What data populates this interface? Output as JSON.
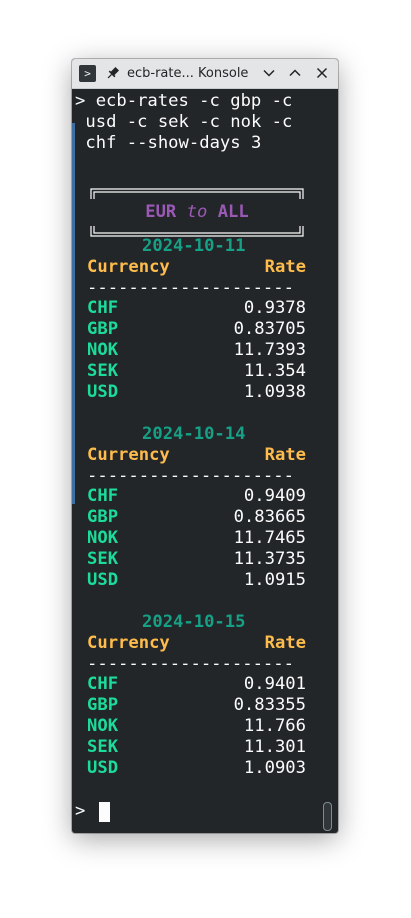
{
  "window": {
    "title": "ecb-rate... Konsole",
    "app_icon_glyph": ">",
    "icons": {
      "app": "terminal-icon",
      "pin": "pin-icon",
      "minimize": "chevron-down-icon",
      "maximize": "chevron-up-icon",
      "close": "close-icon"
    }
  },
  "terminal": {
    "prompt": ">",
    "command_lines": [
      "> ecb-rates -c gbp -c",
      "usd -c sek -c nok -c",
      "chf --show-days 3"
    ],
    "banner": {
      "from": "EUR",
      "to_word": "to",
      "to": "ALL"
    },
    "header": {
      "currency": "Currency",
      "rate": "Rate"
    },
    "divider": "--------------------",
    "days": [
      {
        "date": "2024-10-11",
        "rows": [
          {
            "code": "CHF",
            "rate": "0.9378"
          },
          {
            "code": "GBP",
            "rate": "0.83705"
          },
          {
            "code": "NOK",
            "rate": "11.7393"
          },
          {
            "code": "SEK",
            "rate": "11.354"
          },
          {
            "code": "USD",
            "rate": "1.0938"
          }
        ]
      },
      {
        "date": "2024-10-14",
        "rows": [
          {
            "code": "CHF",
            "rate": "0.9409"
          },
          {
            "code": "GBP",
            "rate": "0.83665"
          },
          {
            "code": "NOK",
            "rate": "11.7465"
          },
          {
            "code": "SEK",
            "rate": "11.3735"
          },
          {
            "code": "USD",
            "rate": "1.0915"
          }
        ]
      },
      {
        "date": "2024-10-15",
        "rows": [
          {
            "code": "CHF",
            "rate": "0.9401"
          },
          {
            "code": "GBP",
            "rate": "0.83355"
          },
          {
            "code": "NOK",
            "rate": "11.766"
          },
          {
            "code": "SEK",
            "rate": "11.301"
          },
          {
            "code": "USD",
            "rate": "1.0903"
          }
        ]
      }
    ],
    "final_prompt": ">"
  },
  "colors": {
    "background": "#232629",
    "currency_code": "#1cdc9a",
    "date": "#16a085",
    "header": "#fdbc4b",
    "banner": "#9b59b6",
    "text": "#fcfcfc"
  }
}
